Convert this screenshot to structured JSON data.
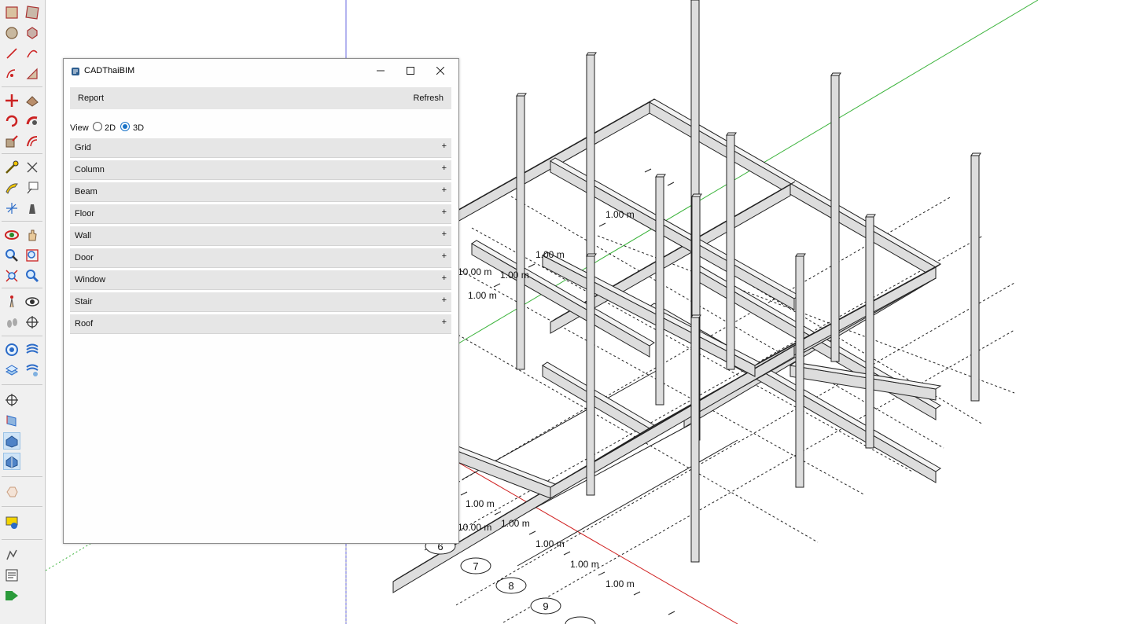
{
  "toolbar": {
    "tools": [
      {
        "name": "rectangle-tool-icon",
        "active": false
      },
      {
        "name": "rotated-rectangle-tool-icon",
        "active": false
      },
      {
        "name": "circle-tool-icon",
        "active": false
      },
      {
        "name": "polygon-tool-icon",
        "active": false
      },
      {
        "name": "line-tool-icon",
        "active": false
      },
      {
        "name": "arc-tool-icon",
        "active": false
      },
      {
        "name": "pie-tool-icon",
        "active": false
      },
      {
        "name": "freehand-tool-icon",
        "active": false
      },
      {
        "name": "move-tool-icon",
        "active": false
      },
      {
        "name": "push-pull-tool-icon",
        "active": false
      },
      {
        "name": "rotate-tool-icon",
        "active": false
      },
      {
        "name": "follow-me-tool-icon",
        "active": false
      },
      {
        "name": "scale-tool-icon",
        "active": false
      },
      {
        "name": "offset-tool-icon",
        "active": false
      },
      {
        "name": "tape-measure-tool-icon",
        "active": false
      },
      {
        "name": "dimension-tool-icon",
        "active": false
      },
      {
        "name": "protractor-tool-icon",
        "active": false
      },
      {
        "name": "text-tool-icon",
        "active": false
      },
      {
        "name": "axes-tool-icon",
        "active": false
      },
      {
        "name": "3d-text-tool-icon",
        "active": false
      },
      {
        "name": "orbit-tool-icon",
        "active": false
      },
      {
        "name": "pan-tool-icon",
        "active": false
      },
      {
        "name": "zoom-tool-icon",
        "active": false
      },
      {
        "name": "zoom-window-tool-icon",
        "active": false
      },
      {
        "name": "zoom-extents-tool-icon",
        "active": false
      },
      {
        "name": "previous-view-tool-icon",
        "active": false
      },
      {
        "name": "position-camera-tool-icon",
        "active": false
      },
      {
        "name": "look-around-tool-icon",
        "active": false
      },
      {
        "name": "walk-tool-icon",
        "active": false
      },
      {
        "name": "section-plane-tool-icon",
        "active": false
      },
      {
        "name": "add-location-tool-icon",
        "active": false
      },
      {
        "name": "sandbox-tool-icon",
        "active": false
      },
      {
        "name": "layers-tool-icon",
        "active": false
      },
      {
        "name": "smoove-tool-icon",
        "active": false
      },
      {
        "name": "section-fill-tool-icon",
        "active": false
      },
      {
        "name": "section-cut-tool-icon",
        "active": false
      },
      {
        "name": "display-section-planes-icon",
        "active": true
      },
      {
        "name": "display-section-cuts-icon",
        "active": true
      },
      {
        "name": "hide-geometry-icon",
        "active": false
      },
      {
        "name": "model-info-icon",
        "active": false
      },
      {
        "name": "instructor-icon",
        "active": false
      },
      {
        "name": "outliner-icon",
        "active": false
      },
      {
        "name": "extension-play-icon",
        "active": false
      }
    ]
  },
  "dialog": {
    "title": "CADThaiBIM",
    "report_label": "Report",
    "refresh_label": "Refresh",
    "view_label": "View",
    "view_options": [
      {
        "label": "2D",
        "selected": false
      },
      {
        "label": "3D",
        "selected": true
      }
    ],
    "sections": [
      {
        "label": "Grid",
        "toggle": "+"
      },
      {
        "label": "Column",
        "toggle": "+"
      },
      {
        "label": "Beam",
        "toggle": "+"
      },
      {
        "label": "Floor",
        "toggle": "+"
      },
      {
        "label": "Wall",
        "toggle": "+"
      },
      {
        "label": "Door",
        "toggle": "+"
      },
      {
        "label": "Window",
        "toggle": "+"
      },
      {
        "label": "Stair",
        "toggle": "+"
      },
      {
        "label": "Roof",
        "toggle": "+"
      }
    ]
  },
  "viewport": {
    "dimension_labels": [
      "1.00 m",
      "1.00 m",
      "1.00 m",
      "10.00 m",
      "1.00 m",
      "10.00 m",
      "1.00 m",
      "1.00 m",
      "1.00 m",
      "1.00 m",
      "1.00 m"
    ],
    "grid_axis_labels": [
      "6",
      "7",
      "8",
      "9"
    ],
    "colors": {
      "red_axis": "#d02020",
      "green_axis": "#3bb33b",
      "blue_axis": "#6a6ae0",
      "member_fill": "#dddddd",
      "member_edge": "#222222"
    }
  }
}
